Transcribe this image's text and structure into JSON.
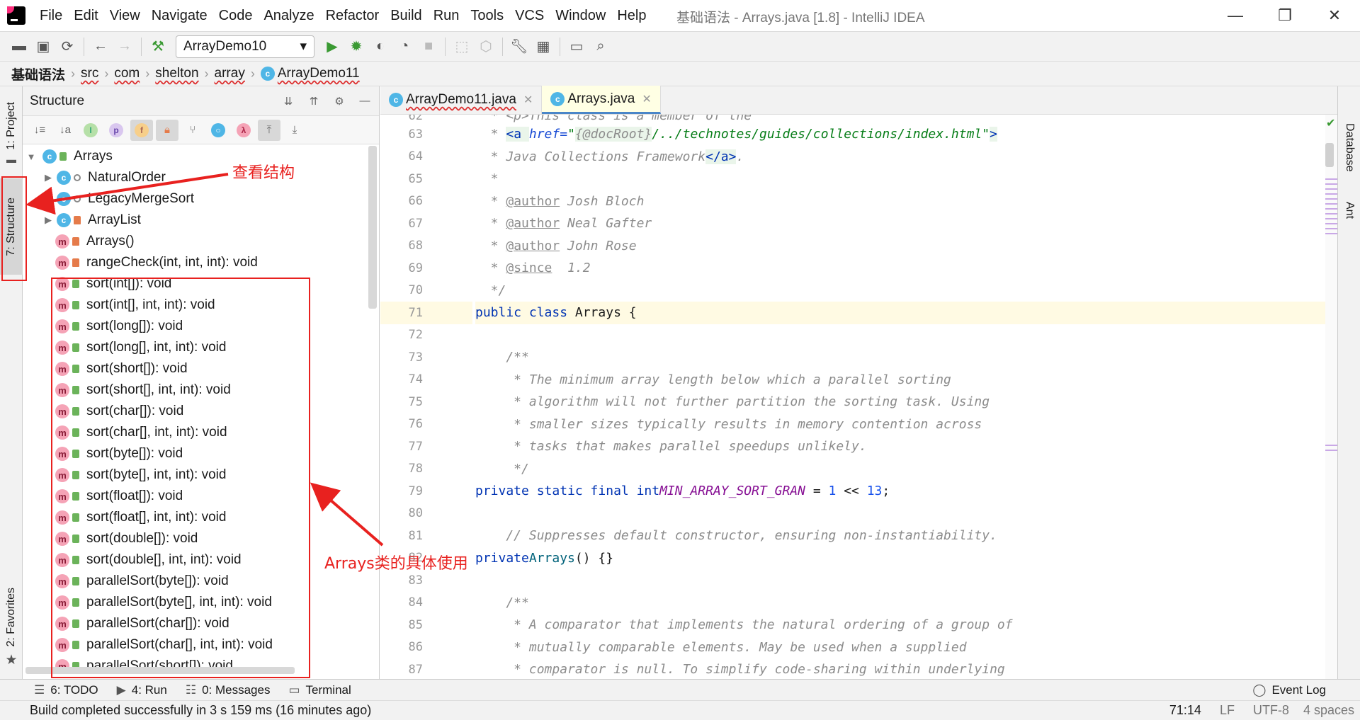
{
  "window": {
    "title": "基础语法 - Arrays.java [1.8] - IntelliJ IDEA"
  },
  "menu": [
    "File",
    "Edit",
    "View",
    "Navigate",
    "Code",
    "Analyze",
    "Refactor",
    "Build",
    "Run",
    "Tools",
    "VCS",
    "Window",
    "Help"
  ],
  "toolbar": {
    "run_config": "ArrayDemo10"
  },
  "breadcrumbs": [
    "基础语法",
    "src",
    "com",
    "shelton",
    "array",
    "ArrayDemo11"
  ],
  "left_strip": {
    "project": "1: Project",
    "structure": "7: Structure",
    "favorites": "2: Favorites"
  },
  "right_strip": {
    "database": "Database",
    "ant": "Ant"
  },
  "structure": {
    "title": "Structure",
    "root": "Arrays",
    "items": [
      {
        "label": "NaturalOrder",
        "kind": "class",
        "vis": "pkg",
        "expandable": true
      },
      {
        "label": "LegacyMergeSort",
        "kind": "class",
        "vis": "pkg",
        "expandable": false
      },
      {
        "label": "ArrayList",
        "kind": "class",
        "vis": "priv",
        "expandable": true
      },
      {
        "label": "Arrays()",
        "kind": "method",
        "vis": "priv",
        "expandable": false
      },
      {
        "label": "rangeCheck(int, int, int): void",
        "kind": "method",
        "vis": "priv",
        "expandable": false
      },
      {
        "label": "sort(int[]): void",
        "kind": "method",
        "vis": "pub",
        "expandable": false
      },
      {
        "label": "sort(int[], int, int): void",
        "kind": "method",
        "vis": "pub",
        "expandable": false
      },
      {
        "label": "sort(long[]): void",
        "kind": "method",
        "vis": "pub",
        "expandable": false
      },
      {
        "label": "sort(long[], int, int): void",
        "kind": "method",
        "vis": "pub",
        "expandable": false
      },
      {
        "label": "sort(short[]): void",
        "kind": "method",
        "vis": "pub",
        "expandable": false
      },
      {
        "label": "sort(short[], int, int): void",
        "kind": "method",
        "vis": "pub",
        "expandable": false
      },
      {
        "label": "sort(char[]): void",
        "kind": "method",
        "vis": "pub",
        "expandable": false
      },
      {
        "label": "sort(char[], int, int): void",
        "kind": "method",
        "vis": "pub",
        "expandable": false
      },
      {
        "label": "sort(byte[]): void",
        "kind": "method",
        "vis": "pub",
        "expandable": false
      },
      {
        "label": "sort(byte[], int, int): void",
        "kind": "method",
        "vis": "pub",
        "expandable": false
      },
      {
        "label": "sort(float[]): void",
        "kind": "method",
        "vis": "pub",
        "expandable": false
      },
      {
        "label": "sort(float[], int, int): void",
        "kind": "method",
        "vis": "pub",
        "expandable": false
      },
      {
        "label": "sort(double[]): void",
        "kind": "method",
        "vis": "pub",
        "expandable": false
      },
      {
        "label": "sort(double[], int, int): void",
        "kind": "method",
        "vis": "pub",
        "expandable": false
      },
      {
        "label": "parallelSort(byte[]): void",
        "kind": "method",
        "vis": "pub",
        "expandable": false
      },
      {
        "label": "parallelSort(byte[], int, int): void",
        "kind": "method",
        "vis": "pub",
        "expandable": false
      },
      {
        "label": "parallelSort(char[]): void",
        "kind": "method",
        "vis": "pub",
        "expandable": false
      },
      {
        "label": "parallelSort(char[], int, int): void",
        "kind": "method",
        "vis": "pub",
        "expandable": false
      },
      {
        "label": "parallelSort(short[]): void",
        "kind": "method",
        "vis": "pub",
        "expandable": false
      }
    ]
  },
  "tabs": [
    {
      "label": "ArrayDemo11.java",
      "active": false
    },
    {
      "label": "Arrays.java",
      "active": true
    }
  ],
  "code": {
    "line_numbers": [
      "62",
      "63",
      "64",
      "65",
      "66",
      "67",
      "68",
      "69",
      "70",
      "71",
      "72",
      "73",
      "74",
      "75",
      "76",
      "77",
      "78",
      "79",
      "80",
      "81",
      "82",
      "83",
      "84",
      "85",
      "86",
      "87"
    ],
    "current_line": "71"
  },
  "annotations": {
    "structure_note": "查看结构",
    "usage_note": "Arrays类的具体使用"
  },
  "bottom_tools": [
    "6: TODO",
    "4: Run",
    "0: Messages",
    "Terminal"
  ],
  "event_log": "Event Log",
  "status": {
    "message": "Build completed successfully in 3 s 159 ms (16 minutes ago)",
    "position": "71:14",
    "line_sep": "LF",
    "encoding": "UTF-8",
    "indent": "4 spaces"
  },
  "colors": {
    "accent": "#4a86c8",
    "annotation": "#e8211f",
    "method_icon": "#f5a3b6",
    "class_icon": "#4fb6e6"
  }
}
